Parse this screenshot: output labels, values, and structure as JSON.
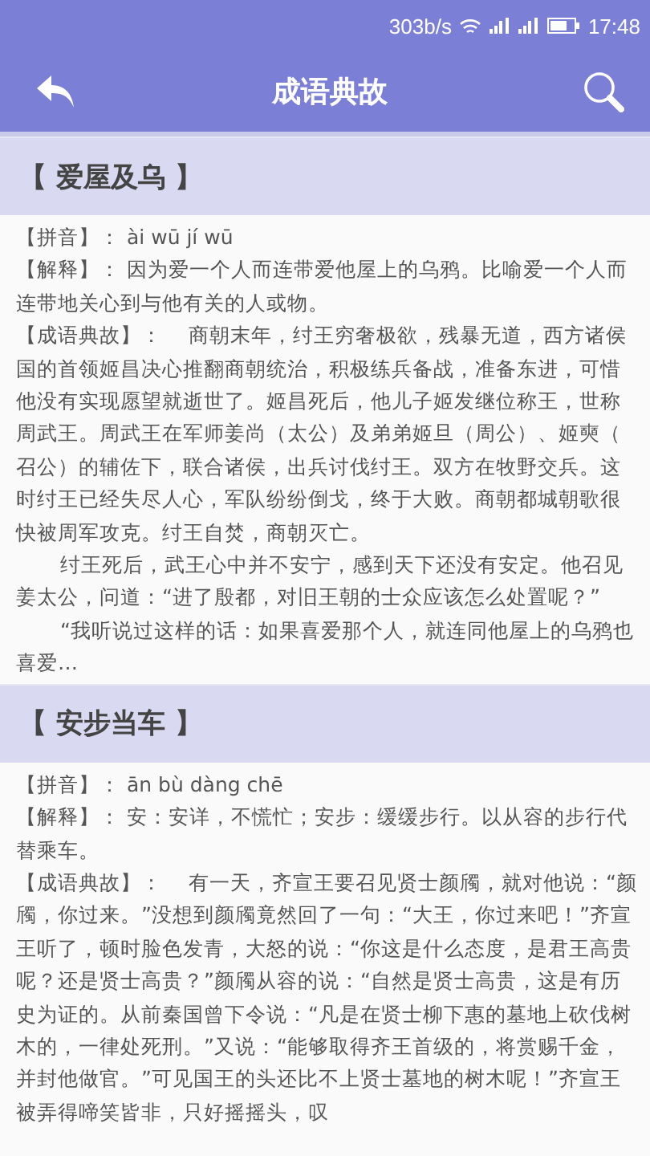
{
  "status_bar": {
    "speed": "303b/s",
    "time": "17:48"
  },
  "app_bar": {
    "title": "成语典故"
  },
  "entries": [
    {
      "title": "【 爱屋及乌 】",
      "pinyin_label": "【拼音】：",
      "pinyin": "ài wū jí wū",
      "meaning_label": "【解释】：",
      "meaning": "因为爱一个人而连带爱他屋上的乌鸦。比喻爱一个人而连带地关心到与他有关的人或物。",
      "story_label": "【成语典故】：",
      "story": [
        "商朝末年，纣王穷奢极欲，残暴无道，西方诸侯国的首领姬昌决心推翻商朝统治，积极练兵备战，准备东进，可惜他没有实现愿望就逝世了。姬昌死后，他儿子姬发继位称王，世称周武王。周武王在军师姜尚（太公）及弟弟姬旦（周公）、姬奭（召公）的辅佐下，联合诸侯，出兵讨伐纣王。双方在牧野交兵。这时纣王已经失尽人心，军队纷纷倒戈，终于大败。商朝都城朝歌很快被周军攻克。纣王自焚，商朝灭亡。",
        "纣王死后，武王心中并不安宁，感到天下还没有安定。他召见姜太公，问道：“进了殷都，对旧王朝的士众应该怎么处置呢？”",
        "“我听说过这样的话：如果喜爱那个人，就连同他屋上的乌鸦也喜爱…"
      ]
    },
    {
      "title": "【 安步当车 】",
      "pinyin_label": "【拼音】：",
      "pinyin": "ān bù dàng chē",
      "meaning_label": "【解释】：",
      "meaning": "安：安详，不慌忙；安步：缓缓步行。以从容的步行代替乘车。",
      "story_label": "【成语典故】：",
      "story": [
        "有一天，齐宣王要召见贤士颜斶，就对他说：“颜斶，你过来。”没想到颜斶竟然回了一句：“大王，你过来吧！”齐宣王听了，顿时脸色发青，大怒的说：“你这是什么态度，是君王高贵呢？还是贤士高贵？”颜斶从容的说：“自然是贤士高贵，这是有历史为证的。从前秦国曾下令说：“凡是在贤士柳下惠的墓地上砍伐树木的，一律处死刑。”又说：“能够取得齐王首级的，将赏赐千金，并封他做官。”可见国王的头还比不上贤士墓地的树木呢！”齐宣王被弄得啼笑皆非，只好摇摇头，叹"
      ]
    }
  ]
}
